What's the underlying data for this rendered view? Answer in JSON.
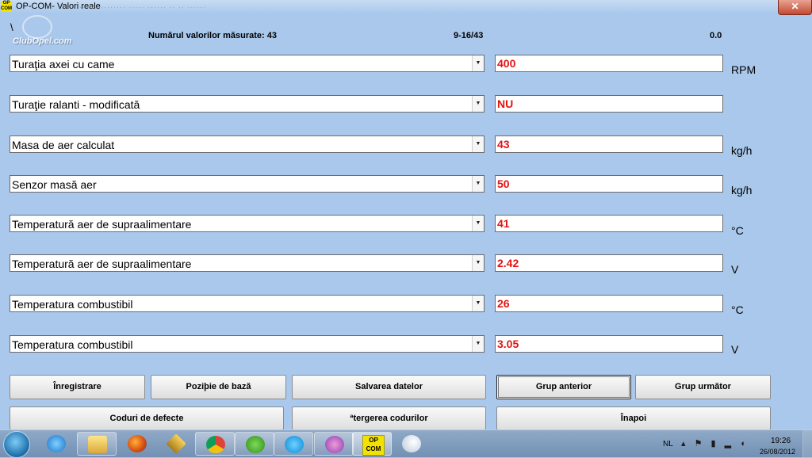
{
  "window": {
    "icon_text": "OP COM",
    "title": "OP-COM- Valori reale",
    "blurred_caption": "··· ·· ········ ····· ······ ·· ·· ······",
    "close_glyph": "✕"
  },
  "logo": {
    "slash": "\\",
    "text": "ClubOpel.com"
  },
  "header": {
    "count_label": "Numărul valorilor măsurate: 43",
    "group_range": "9-16/43",
    "value": "0.0"
  },
  "rows": [
    {
      "param": "Turaţia axei cu came",
      "value": "400",
      "unit": "RPM"
    },
    {
      "param": "Turaţie ralanti - modificată",
      "value": "NU",
      "unit": ""
    },
    {
      "param": "Masa de aer calculat",
      "value": "43",
      "unit": "kg/h"
    },
    {
      "param": "Senzor masă aer",
      "value": "50",
      "unit": "kg/h"
    },
    {
      "param": "Temperatură aer de supraalimentare",
      "value": "41",
      "unit": "°C"
    },
    {
      "param": "Temperatură aer de supraalimentare",
      "value": "2.42",
      "unit": "V"
    },
    {
      "param": "Temperatura combustibil",
      "value": "26",
      "unit": "°C"
    },
    {
      "param": "Temperatura combustibil",
      "value": "3.05",
      "unit": "V"
    }
  ],
  "combo_arrow": "▼",
  "buttons": {
    "record": "Înregistrare",
    "base_position": "Poziþie de bază",
    "save_data": "Salvarea datelor",
    "prev_group": "Grup anterior",
    "next_group": "Grup următor",
    "fault_codes": "Coduri de defecte",
    "clear_codes": "ªtergerea codurilor",
    "back": "Înapoi"
  },
  "taskbar": {
    "opcom_icon_text": "OP COM",
    "language": "NL",
    "tray_icons": "▴ ⚑ ▮ ▂ ◖",
    "time": "19:26",
    "date": "26/08/2012"
  },
  "colors": {
    "background": "#a9c8ec",
    "value_text": "#e21414",
    "opcom_icon": "#f3e200"
  }
}
